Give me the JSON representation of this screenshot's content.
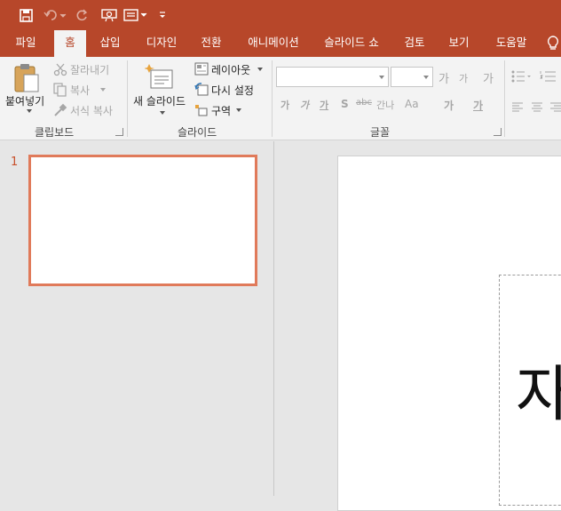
{
  "colors": {
    "accent": "#b7472a",
    "ribbon_bg": "#f3f3f3",
    "pane_bg": "#e6e6e6",
    "thumb_border": "#e07a5a"
  },
  "qat": {
    "icons": [
      "save-icon",
      "undo-icon",
      "redo-icon",
      "start-from-beginning-icon",
      "layout-icon",
      "customize-qat-icon"
    ]
  },
  "tabs": [
    {
      "label": "파일"
    },
    {
      "label": "홈"
    },
    {
      "label": "삽입"
    },
    {
      "label": "디자인"
    },
    {
      "label": "전환"
    },
    {
      "label": "애니메이션"
    },
    {
      "label": "슬라이드 쇼"
    },
    {
      "label": "검토"
    },
    {
      "label": "보기"
    },
    {
      "label": "도움말"
    }
  ],
  "active_tab": "홈",
  "clipboard": {
    "group_label": "클립보드",
    "paste": "붙여넣기",
    "cut": "잘라내기",
    "copy": "복사",
    "format_painter": "서식 복사"
  },
  "slides": {
    "group_label": "슬라이드",
    "new_slide": "새 슬라이드",
    "layout": "레이아웃",
    "reset": "다시 설정",
    "section": "구역"
  },
  "font": {
    "group_label": "글꼴",
    "font_name": "",
    "font_size": "",
    "grow": "가",
    "shrink": "가",
    "bold": "가",
    "italic": "가",
    "underline": "가",
    "shadow": "S",
    "strike": "abc",
    "spacing": "간나",
    "case": "Aa",
    "clear": "가",
    "color": "가"
  },
  "thumbnails": [
    {
      "number": "1"
    }
  ],
  "slide_title_visible": "자"
}
